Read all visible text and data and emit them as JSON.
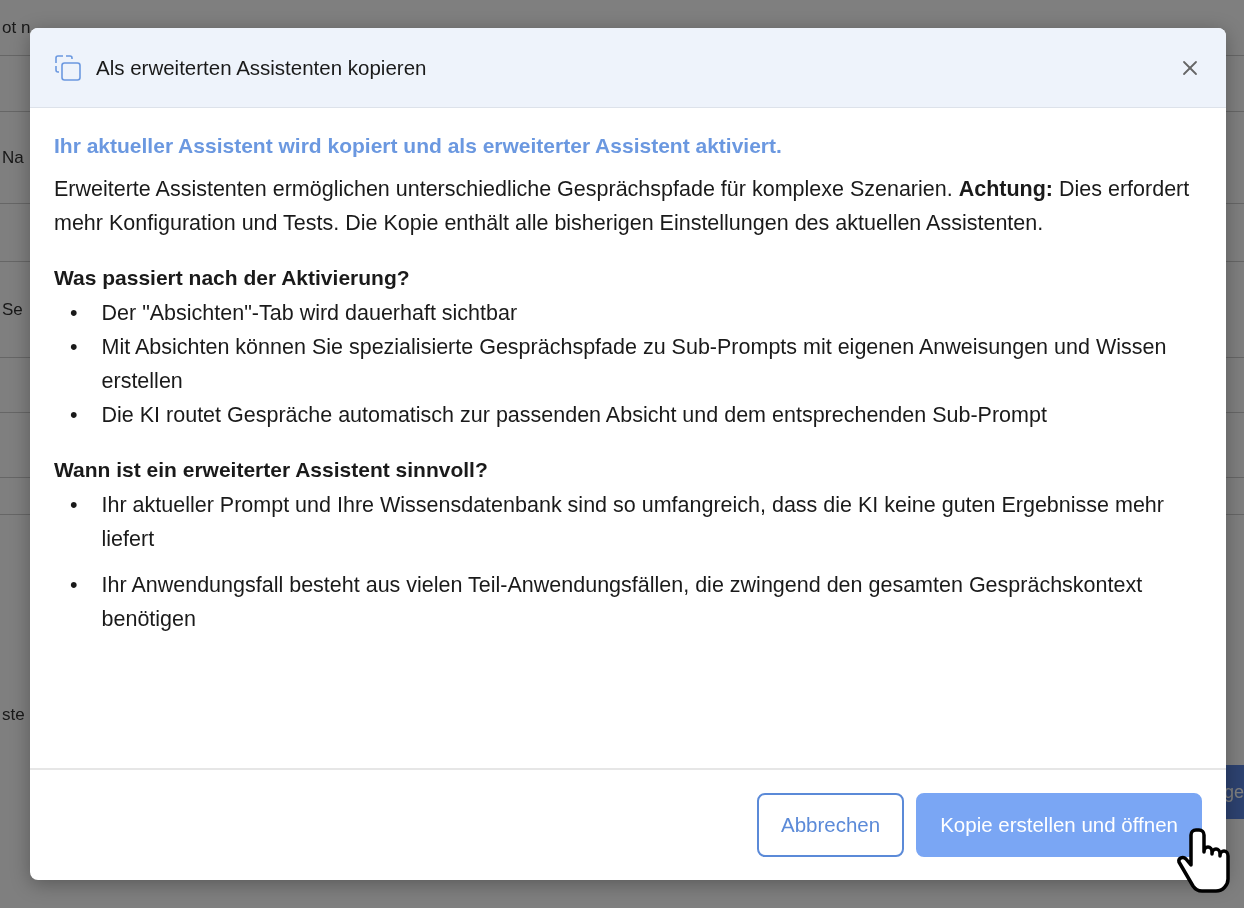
{
  "background": {
    "rows": [
      {
        "text": "ot n"
      },
      {
        "text": ""
      },
      {
        "text": "Na"
      },
      {
        "text": ""
      },
      {
        "text": "Se"
      },
      {
        "text": ""
      },
      {
        "text": ""
      },
      {
        "text": ""
      },
      {
        "text": "ste"
      }
    ],
    "button": "ge"
  },
  "dialog": {
    "title": "Als erweiterten Assistenten kopieren",
    "lead": "Ihr aktueller Assistent wird kopiert und als erweiterter Assistent aktiviert.",
    "intro": "Erweiterte Assistenten ermöglichen unterschiedliche Gesprächspfade für komplexe Szenarien. **Achtung:** Dies erfordert mehr Konfiguration und Tests. Die Kopie enthält alle bisherigen Einstellungen des aktuellen Assistenten.",
    "sections": [
      {
        "heading": "Was passiert nach der Aktivierung?",
        "marker": "•",
        "items": [
          "Der \"Absichten\"-Tab wird dauerhaft sichtbar",
          "Mit Absichten können Sie spezialisierte Gesprächspfade zu Sub-Prompts mit eigenen Anweisungen und Wissen erstellen",
          "Die KI routet Gespräche automatisch zur passenden Absicht und dem entsprechenden Sub-Prompt"
        ]
      },
      {
        "heading": "Wann ist ein erweiterter Assistent sinnvoll?",
        "marker": "•",
        "items": [
          "Ihr aktueller Prompt und Ihre Wissensdatenbank sind so umfangreich, dass die KI keine guten Ergebnisse mehr liefert",
          "Ihr Anwendungsfall besteht aus vielen Teil-Anwendungsfällen, die zwingend den gesamten Gesprächskontext benötigen"
        ]
      }
    ],
    "buttons": [
      {
        "label": "Abbrechen",
        "kind": "secondary"
      },
      {
        "label": "Kopie erstellen und öffnen",
        "kind": "primary"
      }
    ]
  }
}
